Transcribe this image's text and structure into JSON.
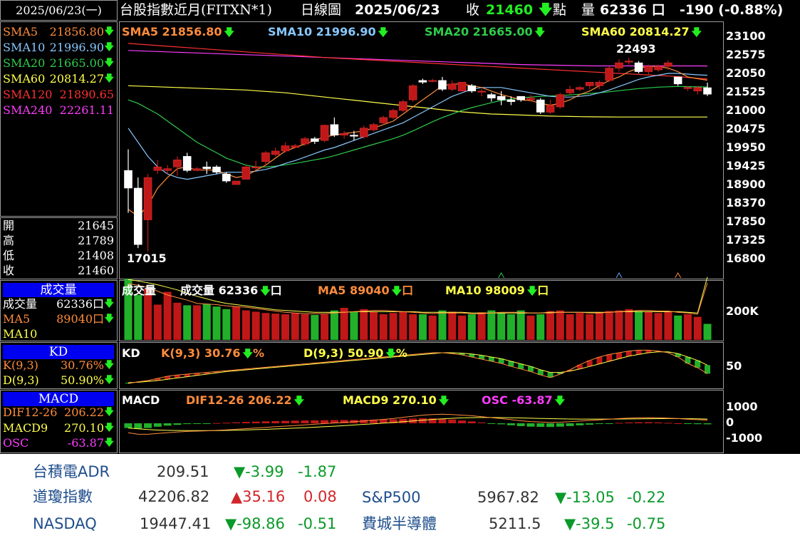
{
  "header": {
    "date": "2025/06/23(一)",
    "title": "台股指數近月(FITXN*1)",
    "period": "日線圖",
    "date2": "2025/06/23",
    "close_label": "收",
    "close_value": "21460",
    "point_label": "點",
    "volume_label": "量",
    "volume_value": "62336 口",
    "change": "-190 (-0.88%)"
  },
  "colors": {
    "sma5": "#ff8c3c",
    "sma10": "#87c8ff",
    "sma20": "#2ecc4a",
    "sma60": "#ffff4a",
    "sma120": "#ff3030",
    "sma240": "#ff3cff",
    "up": "#c01818",
    "down": "#ffffff",
    "arrow_down": "#22ee22",
    "arrow_up": "#ff3030"
  },
  "left_ma": [
    {
      "label": "SMA5",
      "value": "21856.80",
      "arrow": "down",
      "color": "#ff8c3c"
    },
    {
      "label": "SMA10",
      "value": "21996.90",
      "arrow": "down",
      "color": "#87c8ff"
    },
    {
      "label": "SMA20",
      "value": "21665.00",
      "arrow": "down",
      "color": "#2ecc4a"
    },
    {
      "label": "SMA60",
      "value": "20814.27",
      "arrow": "down",
      "color": "#ffff4a"
    },
    {
      "label": "SMA120",
      "value": "21890.65",
      "arrow": "",
      "color": "#ff3030"
    },
    {
      "label": "SMA240",
      "value": "22261.11",
      "arrow": "",
      "color": "#ff3cff"
    }
  ],
  "ohlc": [
    {
      "label": "開",
      "value": "21645"
    },
    {
      "label": "高",
      "value": "21789"
    },
    {
      "label": "低",
      "value": "21408"
    },
    {
      "label": "收",
      "value": "21460"
    }
  ],
  "vol_side": {
    "header": "成交量",
    "rows": [
      {
        "label": "成交量",
        "value": "62336口",
        "color": "#ffffff"
      },
      {
        "label": "MA5",
        "value": "89040口",
        "color": "#ff8c3c"
      },
      {
        "label": "MA10",
        "value": "",
        "color": "#ffff4a"
      }
    ]
  },
  "kd_side": {
    "header": "KD",
    "rows": [
      {
        "label": "K(9,3)",
        "value": "30.76%",
        "color": "#ff8c3c"
      },
      {
        "label": "D(9,3)",
        "value": "50.90%",
        "color": "#ffff4a"
      }
    ]
  },
  "macd_side": {
    "header": "MACD",
    "rows": [
      {
        "label": "DIF12-26",
        "value": "206.22",
        "color": "#ff8c3c"
      },
      {
        "label": "MACD9",
        "value": "270.10",
        "color": "#ffff4a"
      },
      {
        "label": "OSC",
        "value": "-63.87",
        "color": "#ff3cff"
      }
    ]
  },
  "price_legend": [
    {
      "text": "SMA5 21856.80",
      "color": "#ff8c3c"
    },
    {
      "text": "SMA10 21996.90",
      "color": "#87c8ff"
    },
    {
      "text": "SMA20 21665.00",
      "color": "#2ecc4a"
    },
    {
      "text": "SMA60 20814.27",
      "color": "#ffff4a"
    }
  ],
  "vol_legend": [
    {
      "text": "成交量",
      "color": "#ffffff"
    },
    {
      "text": "成交量 62336",
      "color": "#ffffff",
      "suffix": "口"
    },
    {
      "text": "MA5 89040",
      "color": "#ff8c3c",
      "suffix": "口"
    },
    {
      "text": "MA10 98009",
      "color": "#ffff4a",
      "suffix": "口"
    }
  ],
  "kd_legend": [
    {
      "text": "KD",
      "color": "#ffffff"
    },
    {
      "text": "K(9,3) 30.76",
      "color": "#ff8c3c",
      "suffix": "%"
    },
    {
      "text": "D(9,3) 50.90",
      "color": "#ffff4a",
      "suffix": "%"
    }
  ],
  "macd_legend": [
    {
      "text": "MACD",
      "color": "#ffffff"
    },
    {
      "text": "DIF12-26 206.22",
      "color": "#ff8c3c"
    },
    {
      "text": "MACD9 270.10",
      "color": "#ffff4a"
    },
    {
      "text": "OSC -63.87",
      "color": "#ff3cff"
    }
  ],
  "annotations": {
    "high_label": "22493",
    "low_label": "17015"
  },
  "axes": {
    "price_ticks": [
      "23100",
      "22575",
      "22050",
      "21525",
      "21000",
      "20475",
      "19950",
      "19425",
      "18900",
      "18370",
      "17850",
      "17325",
      "16800"
    ],
    "vol_ticks": [
      "200K"
    ],
    "kd_ticks": [
      "50"
    ],
    "macd_ticks": [
      "1000",
      "0",
      "-1000"
    ]
  },
  "chart_data": {
    "type": "candlestick",
    "title": "台股指數近月(FITXN*1) 日線圖",
    "ylim": [
      16600,
      23350
    ],
    "ohlc": [
      [
        19300,
        19900,
        18100,
        18800
      ],
      [
        18800,
        19100,
        17100,
        17200
      ],
      [
        17900,
        19200,
        17000,
        19100
      ],
      [
        19300,
        19600,
        19200,
        19400
      ],
      [
        19300,
        19450,
        19200,
        19350
      ],
      [
        19400,
        19700,
        19150,
        19600
      ],
      [
        19700,
        19800,
        19250,
        19300
      ],
      [
        19300,
        19400,
        19300,
        19350
      ],
      [
        19400,
        19550,
        19200,
        19350
      ],
      [
        19400,
        19450,
        19200,
        19250
      ],
      [
        19200,
        19250,
        18950,
        19000
      ],
      [
        18900,
        19000,
        18900,
        19000
      ],
      [
        19050,
        19450,
        19050,
        19400
      ],
      [
        19380,
        19580,
        19300,
        19400
      ],
      [
        19550,
        19850,
        19450,
        19800
      ],
      [
        19750,
        19950,
        19700,
        19850
      ],
      [
        19850,
        20100,
        19800,
        20000
      ],
      [
        19950,
        20050,
        19950,
        20000
      ],
      [
        20050,
        20250,
        20000,
        20200
      ],
      [
        20200,
        20250,
        20050,
        20120
      ],
      [
        20150,
        20600,
        20100,
        20580
      ],
      [
        20600,
        20800,
        20250,
        20300
      ],
      [
        20300,
        20420,
        20200,
        20350
      ],
      [
        20300,
        20420,
        20150,
        20280
      ],
      [
        20250,
        20570,
        20200,
        20500
      ],
      [
        20450,
        20650,
        20400,
        20600
      ],
      [
        20650,
        20850,
        20600,
        20800
      ],
      [
        20800,
        21050,
        20750,
        21000
      ],
      [
        21000,
        21300,
        20950,
        21250
      ],
      [
        21300,
        21750,
        21250,
        21700
      ],
      [
        21850,
        21900,
        21750,
        21800
      ],
      [
        21850,
        21900,
        21800,
        21850
      ],
      [
        21850,
        21950,
        21550,
        21600
      ],
      [
        21600,
        21850,
        21550,
        21750
      ],
      [
        21550,
        21800,
        21550,
        21800
      ],
      [
        21700,
        21750,
        21500,
        21550
      ],
      [
        21550,
        21600,
        21400,
        21550
      ],
      [
        21450,
        21500,
        21250,
        21350
      ],
      [
        21400,
        21550,
        21150,
        21300
      ],
      [
        21300,
        21400,
        21150,
        21250
      ],
      [
        21400,
        21400,
        21250,
        21300
      ],
      [
        21300,
        21450,
        21250,
        21350
      ],
      [
        21300,
        21350,
        20900,
        20950
      ],
      [
        20950,
        21300,
        20900,
        21150
      ],
      [
        21100,
        21500,
        21050,
        21450
      ],
      [
        21500,
        21700,
        21450,
        21600
      ],
      [
        21600,
        21700,
        21550,
        21650
      ],
      [
        21700,
        21800,
        21600,
        21800
      ],
      [
        21700,
        21850,
        21600,
        21800
      ],
      [
        21850,
        22250,
        21800,
        22200
      ],
      [
        22200,
        22450,
        22100,
        22350
      ],
      [
        22400,
        22493,
        22300,
        22400
      ],
      [
        22350,
        22400,
        22050,
        22100
      ],
      [
        22100,
        22300,
        22000,
        22250
      ],
      [
        22150,
        22300,
        22100,
        22250
      ],
      [
        22250,
        22420,
        22150,
        22350
      ],
      [
        21950,
        21950,
        21700,
        21750
      ],
      [
        21650,
        21700,
        21550,
        21650
      ],
      [
        21550,
        21700,
        21450,
        21650
      ],
      [
        21645,
        21789,
        21408,
        21460
      ]
    ],
    "sma5": [
      18200,
      18000,
      18300,
      18800,
      19100,
      19350,
      19400,
      19300,
      19320,
      19300,
      19200,
      19100,
      19150,
      19300,
      19450,
      19650,
      19850,
      19950,
      20050,
      20150,
      20250,
      20300,
      20350,
      20380,
      20420,
      20500,
      20600,
      20700,
      20900,
      21100,
      21300,
      21500,
      21700,
      21750,
      21750,
      21700,
      21650,
      21550,
      21450,
      21380,
      21300,
      21280,
      21200,
      21150,
      21200,
      21300,
      21450,
      21550,
      21700,
      21850,
      21950,
      22100,
      22200,
      22250,
      22250,
      22200,
      22100,
      21950,
      21900,
      21857
    ],
    "sma10": [
      20500,
      20100,
      19700,
      19400,
      19200,
      19100,
      19050,
      19100,
      19150,
      19200,
      19250,
      19250,
      19250,
      19280,
      19330,
      19400,
      19500,
      19580,
      19680,
      19780,
      19880,
      19950,
      20050,
      20150,
      20250,
      20350,
      20450,
      20550,
      20650,
      20800,
      20950,
      21100,
      21250,
      21400,
      21500,
      21600,
      21650,
      21650,
      21650,
      21600,
      21550,
      21500,
      21450,
      21400,
      21380,
      21380,
      21400,
      21430,
      21500,
      21580,
      21680,
      21780,
      21880,
      21950,
      22000,
      22050,
      22050,
      22030,
      22010,
      21997
    ],
    "sma20": [
      21300,
      21200,
      21050,
      20900,
      20700,
      20500,
      20300,
      20100,
      19950,
      19800,
      19650,
      19550,
      19450,
      19400,
      19400,
      19420,
      19460,
      19500,
      19550,
      19600,
      19650,
      19720,
      19800,
      19880,
      19960,
      20040,
      20120,
      20200,
      20300,
      20420,
      20550,
      20680,
      20800,
      20900,
      21000,
      21080,
      21150,
      21220,
      21280,
      21320,
      21360,
      21380,
      21400,
      21410,
      21420,
      21440,
      21460,
      21480,
      21500,
      21530,
      21560,
      21590,
      21620,
      21640,
      21660,
      21670,
      21680,
      21675,
      21670,
      21665
    ],
    "sma60": [
      21700,
      21690,
      21680,
      21670,
      21660,
      21650,
      21640,
      21630,
      21620,
      21610,
      21600,
      21590,
      21580,
      21560,
      21540,
      21520,
      21500,
      21470,
      21440,
      21410,
      21380,
      21350,
      21320,
      21290,
      21260,
      21230,
      21200,
      21170,
      21140,
      21110,
      21080,
      21050,
      21020,
      20990,
      20960,
      20940,
      20920,
      20900,
      20890,
      20880,
      20870,
      20860,
      20850,
      20840,
      20835,
      20830,
      20825,
      20820,
      20818,
      20816,
      20815,
      20815,
      20815,
      20815,
      20815,
      20815,
      20815,
      20815,
      20815,
      20814
    ],
    "sma120": [
      22900,
      22880,
      22860,
      22840,
      22820,
      22800,
      22780,
      22760,
      22740,
      22720,
      22700,
      22680,
      22660,
      22640,
      22620,
      22600,
      22580,
      22560,
      22540,
      22520,
      22500,
      22485,
      22470,
      22455,
      22440,
      22425,
      22410,
      22395,
      22380,
      22365,
      22350,
      22335,
      22320,
      22305,
      22290,
      22275,
      22260,
      22245,
      22230,
      22215,
      22200,
      22185,
      22170,
      22155,
      22140,
      22125,
      22110,
      22095,
      22080,
      22065,
      22050,
      22035,
      22020,
      22005,
      21990,
      21975,
      21960,
      21935,
      21910,
      21890
    ],
    "sma240": [
      22700,
      22690,
      22680,
      22670,
      22660,
      22650,
      22640,
      22630,
      22620,
      22610,
      22600,
      22590,
      22580,
      22570,
      22560,
      22550,
      22540,
      22530,
      22520,
      22510,
      22500,
      22490,
      22480,
      22470,
      22460,
      22450,
      22440,
      22430,
      22420,
      22410,
      22400,
      22390,
      22380,
      22370,
      22360,
      22350,
      22340,
      22330,
      22320,
      22310,
      22300,
      22295,
      22290,
      22285,
      22280,
      22275,
      22270,
      22265,
      22262,
      22262,
      22262,
      22262,
      22262,
      22262,
      22262,
      22262,
      22262,
      22262,
      22262,
      22261
    ],
    "volume": [
      95,
      70,
      80,
      55,
      75,
      58,
      54,
      54,
      56,
      52,
      48,
      52,
      46,
      44,
      42,
      41,
      40,
      42,
      40,
      39,
      40,
      46,
      50,
      44,
      48,
      44,
      40,
      42,
      44,
      40,
      40,
      38,
      46,
      44,
      38,
      40,
      43,
      46,
      42,
      40,
      46,
      38,
      40,
      45,
      46,
      40,
      42,
      40,
      43,
      45,
      46,
      48,
      45,
      44,
      42,
      44,
      38,
      40,
      36,
      25
    ],
    "vol_ma5": [
      88,
      85,
      82,
      76,
      70,
      66,
      62,
      57,
      56,
      55,
      53,
      52,
      51,
      49,
      47,
      45,
      43,
      42,
      41,
      41,
      41,
      42,
      43,
      44,
      45,
      46,
      46,
      45,
      44,
      43,
      42,
      41,
      42,
      42,
      42,
      41,
      41,
      42,
      43,
      43,
      43,
      42,
      42,
      42,
      43,
      43,
      43,
      42,
      42,
      43,
      44,
      45,
      46,
      46,
      45,
      45,
      43,
      42,
      40,
      89
    ],
    "vol_ma10": [
      94,
      92,
      89,
      86,
      82,
      78,
      73,
      68,
      64,
      60,
      57,
      55,
      53,
      51,
      49,
      47,
      46,
      45,
      44,
      43,
      43,
      43,
      43,
      44,
      44,
      44,
      44,
      44,
      44,
      44,
      43,
      43,
      43,
      43,
      43,
      42,
      42,
      42,
      42,
      42,
      42,
      42,
      42,
      43,
      43,
      43,
      43,
      43,
      43,
      43,
      44,
      44,
      44,
      44,
      44,
      44,
      44,
      43,
      42,
      98
    ],
    "k": [
      8,
      12,
      15,
      20,
      25,
      28,
      30,
      32,
      34,
      36,
      38,
      40,
      42,
      44,
      46,
      48,
      50,
      52,
      54,
      56,
      58,
      60,
      62,
      64,
      66,
      68,
      70,
      72,
      74,
      76,
      78,
      80,
      80,
      78,
      75,
      70,
      65,
      60,
      55,
      48,
      42,
      36,
      28,
      22,
      30,
      40,
      52,
      62,
      70,
      76,
      80,
      84,
      86,
      86,
      84,
      80,
      70,
      55,
      45,
      31
    ],
    "d": [
      10,
      11,
      13,
      15,
      18,
      21,
      24,
      27,
      30,
      33,
      36,
      38,
      40,
      42,
      44,
      46,
      48,
      50,
      52,
      54,
      56,
      58,
      60,
      62,
      64,
      66,
      68,
      70,
      72,
      74,
      76,
      78,
      80,
      80,
      79,
      77,
      74,
      70,
      66,
      60,
      54,
      48,
      40,
      34,
      34,
      37,
      42,
      48,
      54,
      60,
      66,
      72,
      76,
      80,
      82,
      82,
      78,
      70,
      62,
      51
    ],
    "dif": [
      -600,
      -700,
      -700,
      -650,
      -600,
      -560,
      -520,
      -500,
      -480,
      -450,
      -420,
      -380,
      -340,
      -300,
      -260,
      -220,
      -180,
      -140,
      -100,
      -60,
      -20,
      20,
      60,
      100,
      150,
      200,
      250,
      300,
      380,
      450,
      520,
      560,
      580,
      560,
      520,
      480,
      420,
      360,
      300,
      230,
      160,
      110,
      80,
      60,
      70,
      100,
      140,
      180,
      220,
      260,
      300,
      330,
      350,
      360,
      350,
      330,
      300,
      260,
      230,
      206
    ],
    "macd": [
      -300,
      -350,
      -400,
      -430,
      -450,
      -460,
      -470,
      -470,
      -470,
      -465,
      -455,
      -440,
      -425,
      -405,
      -385,
      -360,
      -335,
      -310,
      -280,
      -250,
      -220,
      -185,
      -150,
      -110,
      -70,
      -30,
      10,
      50,
      100,
      150,
      200,
      245,
      285,
      320,
      345,
      360,
      370,
      370,
      365,
      355,
      340,
      325,
      310,
      295,
      285,
      275,
      270,
      268,
      268,
      270,
      273,
      278,
      283,
      290,
      296,
      300,
      300,
      295,
      285,
      270
    ],
    "osc": [
      -300,
      -350,
      -300,
      -220,
      -150,
      -100,
      -50,
      -30,
      -10,
      15,
      35,
      60,
      85,
      105,
      125,
      140,
      155,
      170,
      180,
      190,
      200,
      205,
      210,
      210,
      220,
      230,
      240,
      250,
      280,
      300,
      320,
      315,
      295,
      240,
      175,
      120,
      50,
      -10,
      -65,
      -125,
      -180,
      -215,
      -230,
      -235,
      -215,
      -175,
      -130,
      -88,
      -48,
      -10,
      27,
      52,
      67,
      70,
      54,
      30,
      0,
      -35,
      -55,
      -64
    ]
  }
}
